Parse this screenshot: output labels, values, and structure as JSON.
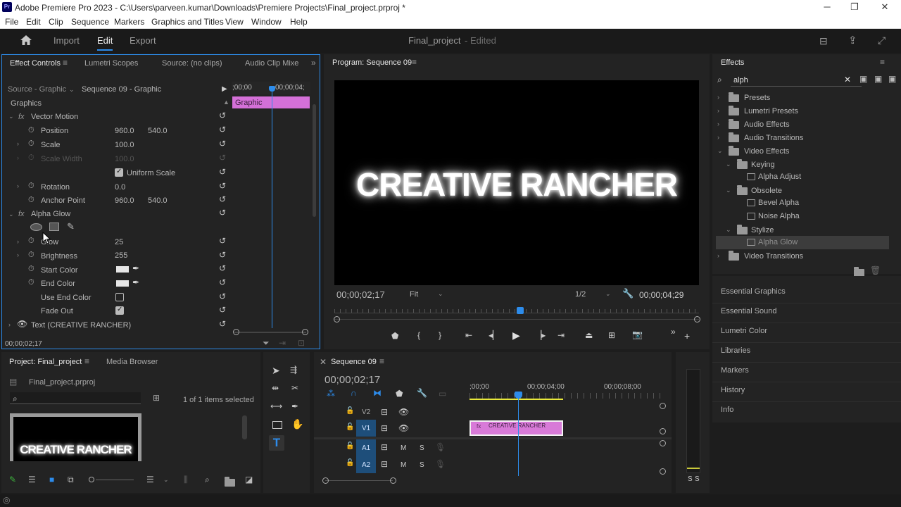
{
  "titlebar": {
    "title": "Adobe Premiere Pro 2023 - C:\\Users\\parveen.kumar\\Downloads\\Premiere Projects\\Final_project.prproj *",
    "app_badge": "Pr"
  },
  "menu": [
    "File",
    "Edit",
    "Clip",
    "Sequence",
    "Markers",
    "Graphics and Titles",
    "View",
    "Window",
    "Help"
  ],
  "workspace": {
    "import": "Import",
    "edit": "Edit",
    "export": "Export",
    "project_name": "Final_project",
    "status": "- Edited"
  },
  "effect_controls": {
    "tabs": [
      "Effect Controls",
      "Lumetri Scopes",
      "Source: (no clips)",
      "Audio Clip Mixe"
    ],
    "source": "Source - Graphic",
    "sequence": "Sequence 09 - Graphic",
    "ruler_start": ";00;00",
    "ruler_end": "00;00;04;",
    "clip_label": "Graphic",
    "section": "Graphics",
    "vector_motion": "Vector Motion",
    "position_label": "Position",
    "position_x": "960.0",
    "position_y": "540.0",
    "scale_label": "Scale",
    "scale_value": "100.0",
    "scale_width_label": "Scale Width",
    "scale_width_value": "100.0",
    "uniform_scale": "Uniform Scale",
    "rotation_label": "Rotation",
    "rotation_value": "0.0",
    "anchor_label": "Anchor Point",
    "anchor_x": "960.0",
    "anchor_y": "540.0",
    "alpha_glow": "Alpha Glow",
    "glow_label": "Glow",
    "glow_value": "25",
    "brightness_label": "Brightness",
    "brightness_value": "255",
    "start_color": "Start Color",
    "end_color": "End Color",
    "use_end_color": "Use End Color",
    "fade_out": "Fade Out",
    "text_layer": "Text (CREATIVE RANCHER)",
    "timecode": "00;00;02;17"
  },
  "program": {
    "title": "Program: Sequence 09",
    "video_text": "CREATIVE RANCHER",
    "timecode": "00;00;02;17",
    "fit": "Fit",
    "resolution": "1/2",
    "duration": "00;00;04;29"
  },
  "effects": {
    "title": "Effects",
    "search_value": "alph",
    "tree": [
      {
        "label": "Presets",
        "type": "folder"
      },
      {
        "label": "Lumetri Presets",
        "type": "folder"
      },
      {
        "label": "Audio Effects",
        "type": "folder"
      },
      {
        "label": "Audio Transitions",
        "type": "folder"
      },
      {
        "label": "Video Effects",
        "type": "folder"
      },
      {
        "label": "Keying",
        "type": "folder"
      },
      {
        "label": "Alpha Adjust",
        "type": "effect"
      },
      {
        "label": "Obsolete",
        "type": "folder"
      },
      {
        "label": "Bevel Alpha",
        "type": "effect"
      },
      {
        "label": "Noise Alpha",
        "type": "effect"
      },
      {
        "label": "Stylize",
        "type": "folder"
      },
      {
        "label": "Alpha Glow",
        "type": "effect"
      },
      {
        "label": "Video Transitions",
        "type": "folder"
      }
    ],
    "panels": [
      "Essential Graphics",
      "Essential Sound",
      "Lumetri Color",
      "Libraries",
      "Markers",
      "History",
      "Info"
    ]
  },
  "project": {
    "tabs": [
      "Project: Final_project",
      "Media Browser"
    ],
    "file": "Final_project.prproj",
    "selection": "1 of 1 items selected",
    "thumb_text": "CREATIVE RANCHER"
  },
  "timeline": {
    "title": "Sequence 09",
    "timecode": "00;00;02;17",
    "ruler": [
      ";00;00",
      "00;00;04;00",
      "00;00;08;00"
    ],
    "tracks": [
      "V2",
      "V1",
      "A1",
      "A2"
    ],
    "clip": "CREATIVE RANCHER",
    "mute": "M",
    "solo": "S",
    "meter_labels": [
      "S",
      "S"
    ]
  }
}
